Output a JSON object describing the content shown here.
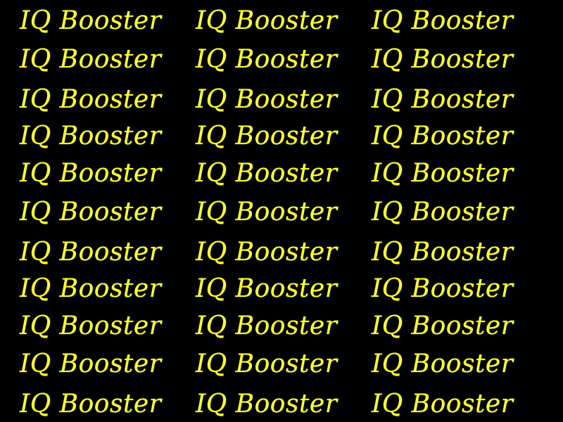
{
  "screen": {
    "background": "#000000",
    "text_color": "#ffff33",
    "tile_text": "IQ Booster",
    "rows": 11,
    "columns": 3
  }
}
